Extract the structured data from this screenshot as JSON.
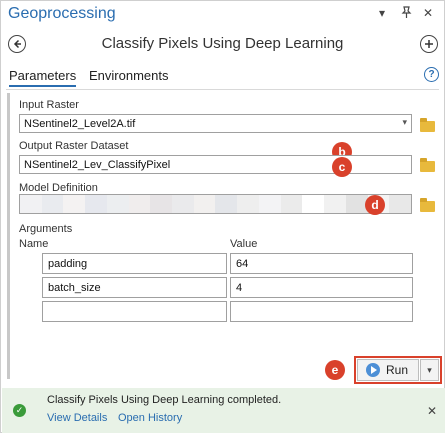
{
  "app_title": "Geoprocessing",
  "window_controls": {
    "menu": "▾",
    "pin": "⊕",
    "close": "✕"
  },
  "tool_title": "Classify Pixels Using Deep Learning",
  "tabs": [
    {
      "label": "Parameters",
      "active": true
    },
    {
      "label": "Environments",
      "active": false
    }
  ],
  "help_icon": "?",
  "fields": {
    "input_raster": {
      "label": "Input Raster",
      "value": "NSentinel2_Level2A.tif"
    },
    "output_raster": {
      "label": "Output Raster Dataset",
      "value": "NSentinel2_Lev_ClassifyPixel"
    },
    "model_definition": {
      "label": "Model Definition",
      "value_obscured": true
    }
  },
  "arguments": {
    "label": "Arguments",
    "headers": {
      "name": "Name",
      "value": "Value"
    },
    "rows": [
      {
        "name": "padding",
        "value": "64"
      },
      {
        "name": "batch_size",
        "value": "4"
      },
      {
        "name": "",
        "value": ""
      }
    ]
  },
  "badges": {
    "b": "b",
    "c": "c",
    "d": "d",
    "e": "e"
  },
  "run_button": {
    "label": "Run"
  },
  "status": {
    "message": "Classify Pixels Using Deep Learning completed.",
    "links": {
      "details": "View Details",
      "history": "Open History"
    }
  },
  "colors": {
    "accent": "#2a6db0",
    "badge": "#d9412b",
    "success_bg": "#e8f2e6",
    "success": "#3a9b3a"
  }
}
